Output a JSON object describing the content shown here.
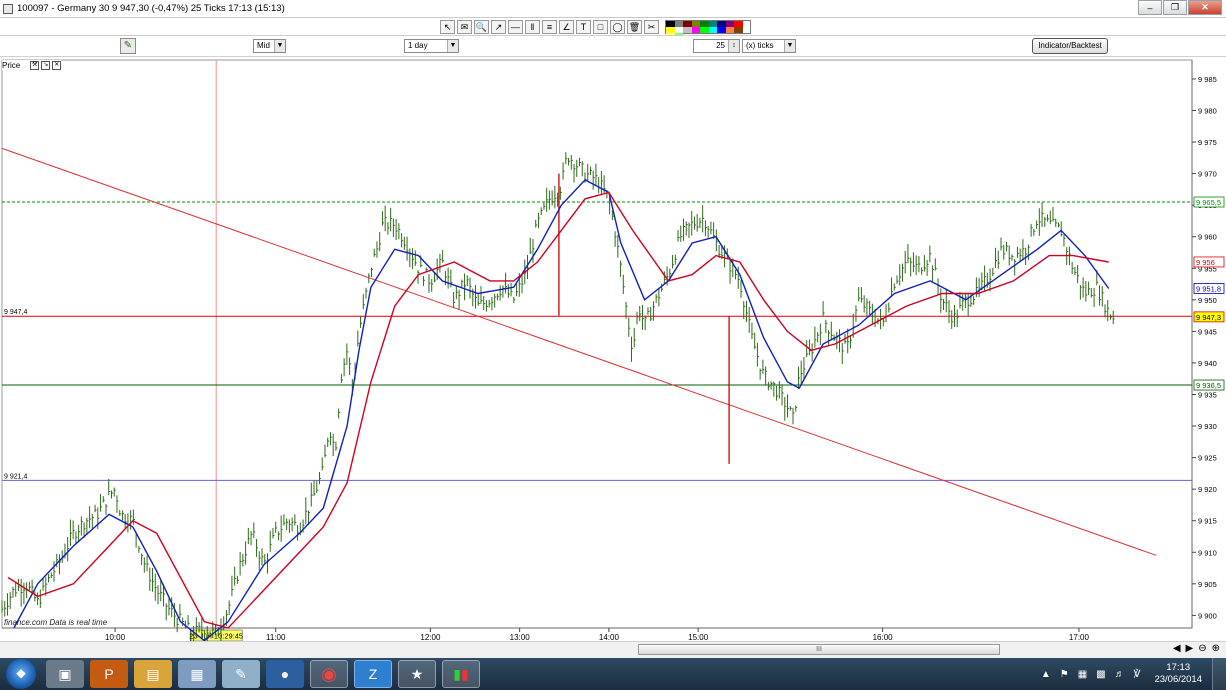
{
  "window": {
    "title": "100097 - Germany 30    9 947,30 (-0,47%)    25 Ticks  17:13 (15:13)"
  },
  "toolbar": {
    "drawing_tools": [
      "pointer-icon",
      "alarm-icon",
      "zoom-icon",
      "line-icon",
      "horizontal-line-icon",
      "vertical-line-icon",
      "fibonacci-icon",
      "fan-icon",
      "text-icon",
      "channel-icon",
      "ellipse-icon",
      "delete-icon",
      "eraser-icon"
    ],
    "palette": [
      "#000000",
      "#7f7f7f",
      "#800000",
      "#808000",
      "#008000",
      "#008080",
      "#000080",
      "#800080",
      "#ff0000",
      "#ffff00",
      "#ffffff",
      "#c0c0c0",
      "#ff00ff",
      "#00ff00",
      "#00ffff",
      "#0000ff",
      "#ff8040",
      "#804000",
      "#ffff80",
      "#80ff80"
    ]
  },
  "options": {
    "price_type": "Mid",
    "period": "1 day",
    "ticks_value": "25",
    "ticks_unit": "(x) ticks",
    "indicator_button": "Indicator/Backtest"
  },
  "panel": {
    "label": "Price"
  },
  "chart_data": {
    "type": "line",
    "title": "",
    "ylim": [
      9898,
      9988
    ],
    "y_ticks": [
      "9 985",
      "9 980",
      "9 975",
      "9 970",
      "9 965",
      "9 960",
      "9 955",
      "9 950",
      "9 945",
      "9 940",
      "9 935",
      "9 930",
      "9 925",
      "9 920",
      "9 915",
      "9 910",
      "9 905",
      "9 900"
    ],
    "y_tick_values": [
      9985,
      9980,
      9975,
      9970,
      9965,
      9960,
      9955,
      9950,
      9945,
      9940,
      9935,
      9930,
      9925,
      9920,
      9915,
      9910,
      9905,
      9900
    ],
    "x_ticks": [
      "10:00",
      "11:00",
      "12:00",
      "13:00",
      "14:00",
      "15:00",
      "16:00",
      "17:00"
    ],
    "x_tick_pos": [
      0.095,
      0.23,
      0.36,
      0.435,
      0.51,
      0.585,
      0.74,
      0.905
    ],
    "cursor_label": "23 Jun 10:29:45",
    "cursor_pos": 0.18,
    "watermark": "finance.com  Data is real time",
    "horizontal_lines": [
      {
        "label": "9 947,4",
        "value": 9947.4,
        "color": "#e00000",
        "style": "solid"
      },
      {
        "label": "9 921,4",
        "value": 9921.4,
        "color": "#6060e0",
        "style": "solid"
      },
      {
        "label": "",
        "value": 9965.5,
        "color": "#009000",
        "style": "dashed"
      },
      {
        "label": "",
        "value": 9936.5,
        "color": "#006000",
        "style": "solid"
      }
    ],
    "right_labels": [
      {
        "text": "9 965,5",
        "value": 9965.5,
        "color": "#009000"
      },
      {
        "text": "9 956",
        "value": 9956,
        "color": "#e00000"
      },
      {
        "text": "9 951,8",
        "value": 9951.8,
        "color": "#0000c0"
      },
      {
        "text": "9 947,3",
        "value": 9947.3,
        "color": "#e00000",
        "fill": "#ffff00"
      },
      {
        "text": "9 936,5",
        "value": 9936.5,
        "color": "#006000"
      }
    ],
    "trendline": {
      "color": "#e03030",
      "from": [
        0.0,
        9974
      ],
      "to": [
        0.97,
        9909.5
      ]
    },
    "price_series": {
      "name": "",
      "color": "#2e6b1a",
      "points": [
        [
          0.0,
          9901
        ],
        [
          0.01,
          9904
        ],
        [
          0.02,
          9905
        ],
        [
          0.03,
          9902
        ],
        [
          0.04,
          9906
        ],
        [
          0.05,
          9909
        ],
        [
          0.06,
          9913
        ],
        [
          0.07,
          9915
        ],
        [
          0.08,
          9916
        ],
        [
          0.09,
          9919
        ],
        [
          0.095,
          9920
        ],
        [
          0.1,
          9916
        ],
        [
          0.11,
          9915
        ],
        [
          0.12,
          9908
        ],
        [
          0.13,
          9904
        ],
        [
          0.14,
          9901
        ],
        [
          0.15,
          9899
        ],
        [
          0.16,
          9897
        ],
        [
          0.17,
          9898
        ],
        [
          0.18,
          9897
        ],
        [
          0.19,
          9901
        ],
        [
          0.2,
          9908
        ],
        [
          0.21,
          9913
        ],
        [
          0.22,
          9908
        ],
        [
          0.23,
          9913
        ],
        [
          0.24,
          9915
        ],
        [
          0.25,
          9914
        ],
        [
          0.26,
          9918
        ],
        [
          0.27,
          9923
        ],
        [
          0.275,
          9930
        ],
        [
          0.28,
          9926
        ],
        [
          0.285,
          9938
        ],
        [
          0.29,
          9942
        ],
        [
          0.295,
          9936
        ],
        [
          0.3,
          9945
        ],
        [
          0.31,
          9955
        ],
        [
          0.315,
          9958
        ],
        [
          0.32,
          9962
        ],
        [
          0.33,
          9962
        ],
        [
          0.34,
          9959
        ],
        [
          0.35,
          9955
        ],
        [
          0.36,
          9953
        ],
        [
          0.37,
          9956
        ],
        [
          0.38,
          9950
        ],
        [
          0.39,
          9953
        ],
        [
          0.4,
          9949
        ],
        [
          0.41,
          9950
        ],
        [
          0.42,
          9952
        ],
        [
          0.43,
          9950
        ],
        [
          0.44,
          9954
        ],
        [
          0.45,
          9962
        ],
        [
          0.46,
          9966
        ],
        [
          0.47,
          9968
        ],
        [
          0.475,
          9973
        ],
        [
          0.48,
          9972
        ],
        [
          0.49,
          9970
        ],
        [
          0.5,
          9969
        ],
        [
          0.51,
          9966
        ],
        [
          0.515,
          9961
        ],
        [
          0.52,
          9955
        ],
        [
          0.525,
          9948
        ],
        [
          0.53,
          9942
        ],
        [
          0.535,
          9949
        ],
        [
          0.54,
          9946
        ],
        [
          0.55,
          9950
        ],
        [
          0.56,
          9954
        ],
        [
          0.57,
          9960
        ],
        [
          0.58,
          9962
        ],
        [
          0.59,
          9963
        ],
        [
          0.6,
          9959
        ],
        [
          0.61,
          9956
        ],
        [
          0.62,
          9953
        ],
        [
          0.63,
          9944
        ],
        [
          0.64,
          9938
        ],
        [
          0.65,
          9936
        ],
        [
          0.66,
          9933
        ],
        [
          0.665,
          9931
        ],
        [
          0.67,
          9938
        ],
        [
          0.68,
          9942
        ],
        [
          0.69,
          9947
        ],
        [
          0.7,
          9944
        ],
        [
          0.71,
          9942
        ],
        [
          0.72,
          9950
        ],
        [
          0.73,
          9948
        ],
        [
          0.74,
          9946
        ],
        [
          0.75,
          9953
        ],
        [
          0.76,
          9956
        ],
        [
          0.77,
          9955
        ],
        [
          0.78,
          9957
        ],
        [
          0.79,
          9950
        ],
        [
          0.8,
          9947
        ],
        [
          0.81,
          9950
        ],
        [
          0.82,
          9951
        ],
        [
          0.83,
          9954
        ],
        [
          0.84,
          9958
        ],
        [
          0.85,
          9957
        ],
        [
          0.86,
          9958
        ],
        [
          0.87,
          9963
        ],
        [
          0.88,
          9962
        ],
        [
          0.89,
          9961
        ],
        [
          0.9,
          9955
        ],
        [
          0.91,
          9951
        ],
        [
          0.92,
          9952
        ],
        [
          0.93,
          9948
        ],
        [
          0.935,
          9947
        ]
      ]
    },
    "ma_fast": {
      "name": "",
      "color": "#1020c0",
      "points": [
        [
          0.01,
          9898
        ],
        [
          0.03,
          9905
        ],
        [
          0.06,
          9911
        ],
        [
          0.09,
          9916
        ],
        [
          0.11,
          9914
        ],
        [
          0.13,
          9907
        ],
        [
          0.15,
          9899
        ],
        [
          0.17,
          9896
        ],
        [
          0.19,
          9899
        ],
        [
          0.22,
          9908
        ],
        [
          0.25,
          9913
        ],
        [
          0.27,
          9917
        ],
        [
          0.29,
          9930
        ],
        [
          0.3,
          9942
        ],
        [
          0.31,
          9952
        ],
        [
          0.33,
          9958
        ],
        [
          0.35,
          9957
        ],
        [
          0.37,
          9953
        ],
        [
          0.4,
          9951
        ],
        [
          0.43,
          9952
        ],
        [
          0.45,
          9958
        ],
        [
          0.47,
          9965
        ],
        [
          0.49,
          9969
        ],
        [
          0.51,
          9967
        ],
        [
          0.52,
          9959
        ],
        [
          0.54,
          9950
        ],
        [
          0.56,
          9953
        ],
        [
          0.58,
          9959
        ],
        [
          0.6,
          9960
        ],
        [
          0.62,
          9954
        ],
        [
          0.64,
          9944
        ],
        [
          0.66,
          9937
        ],
        [
          0.67,
          9936
        ],
        [
          0.69,
          9943
        ],
        [
          0.72,
          9946
        ],
        [
          0.75,
          9951
        ],
        [
          0.78,
          9953
        ],
        [
          0.81,
          9950
        ],
        [
          0.84,
          9954
        ],
        [
          0.87,
          9958
        ],
        [
          0.89,
          9961
        ],
        [
          0.91,
          9957
        ],
        [
          0.93,
          9951.8
        ]
      ]
    },
    "ma_slow": {
      "name": "",
      "color": "#d00020",
      "points": [
        [
          0.005,
          9906
        ],
        [
          0.03,
          9903
        ],
        [
          0.06,
          9905
        ],
        [
          0.09,
          9911
        ],
        [
          0.11,
          9915
        ],
        [
          0.13,
          9913
        ],
        [
          0.15,
          9906
        ],
        [
          0.17,
          9899
        ],
        [
          0.19,
          9898
        ],
        [
          0.21,
          9902
        ],
        [
          0.24,
          9908
        ],
        [
          0.27,
          9914
        ],
        [
          0.29,
          9921
        ],
        [
          0.31,
          9937
        ],
        [
          0.33,
          9949
        ],
        [
          0.35,
          9954
        ],
        [
          0.38,
          9956
        ],
        [
          0.41,
          9953
        ],
        [
          0.43,
          9953
        ],
        [
          0.45,
          9956
        ],
        [
          0.47,
          9961
        ],
        [
          0.49,
          9966
        ],
        [
          0.51,
          9967
        ],
        [
          0.53,
          9961
        ],
        [
          0.56,
          9953
        ],
        [
          0.58,
          9954
        ],
        [
          0.6,
          9957
        ],
        [
          0.62,
          9956
        ],
        [
          0.64,
          9950
        ],
        [
          0.66,
          9945
        ],
        [
          0.68,
          9942
        ],
        [
          0.7,
          9943
        ],
        [
          0.73,
          9946
        ],
        [
          0.76,
          9949
        ],
        [
          0.79,
          9951
        ],
        [
          0.82,
          9951
        ],
        [
          0.85,
          9953
        ],
        [
          0.88,
          9957
        ],
        [
          0.9,
          9957
        ],
        [
          0.93,
          9956
        ]
      ]
    },
    "vertical_segments": [
      {
        "x": 0.468,
        "from": 9947.5,
        "to": 9970,
        "color": "#d00000"
      },
      {
        "x": 0.611,
        "from": 9924,
        "to": 9947.4,
        "color": "#d00000"
      }
    ]
  },
  "scrollbar": {
    "thumb_label": "III"
  },
  "taskbar": {
    "apps": [
      "screenshot-app-icon",
      "powerpoint-icon",
      "folder-icon",
      "calculator-icon",
      "paint-icon",
      "outlook-icon",
      "chrome-icon",
      "z-app-icon",
      "network-icon",
      "trading-app-icon"
    ],
    "clock_time": "17:13",
    "clock_date": "23/06/2014"
  }
}
